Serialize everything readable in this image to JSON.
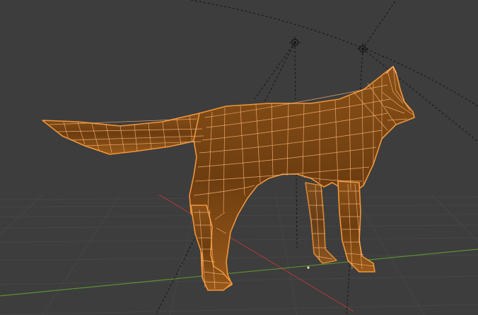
{
  "viewport": {
    "mode": "edit-mode-wireframe",
    "background": "#3d3d3d",
    "grid_color": "#464646",
    "axis_x_color": "#a33838",
    "axis_y_color": "#5c8f33",
    "selection_color": "#f0963a",
    "wire_color": "#f7b071"
  },
  "scene_objects": [
    {
      "name": "wolf-mesh",
      "selected": true
    },
    {
      "name": "light-object-1",
      "icon": "light-icon"
    },
    {
      "name": "light-object-2",
      "icon": "light-icon"
    },
    {
      "name": "3d-cursor-origin",
      "icon": "origin-dot"
    }
  ]
}
